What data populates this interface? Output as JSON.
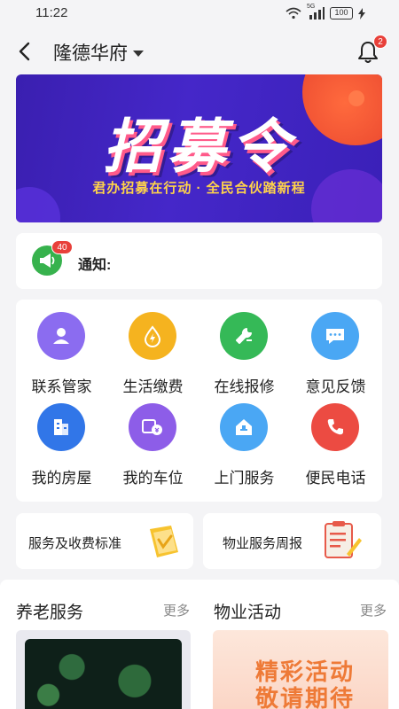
{
  "status_bar": {
    "time": "11:22",
    "battery": "100",
    "network": "5G"
  },
  "header": {
    "community_name": "隆德华府",
    "notification_count": "2"
  },
  "banner": {
    "title": "招募令",
    "subtitle": "君办招募在行动 · 全民合伙踏新程"
  },
  "notice": {
    "label": "通知:",
    "badge_count": "40"
  },
  "services": [
    {
      "label": "联系管家",
      "icon": "user-icon",
      "color": "#8b6cf0"
    },
    {
      "label": "生活缴费",
      "icon": "water-drop-icon",
      "color": "#f5b31f"
    },
    {
      "label": "在线报修",
      "icon": "wrench-icon",
      "color": "#35b957"
    },
    {
      "label": "意见反馈",
      "icon": "chat-bubble-icon",
      "color": "#4aa7f4"
    },
    {
      "label": "我的房屋",
      "icon": "building-icon",
      "color": "#3176e8"
    },
    {
      "label": "我的车位",
      "icon": "parking-icon",
      "color": "#8d5de8"
    },
    {
      "label": "上门服务",
      "icon": "house-service-icon",
      "color": "#4aa7f4"
    },
    {
      "label": "便民电话",
      "icon": "phone-icon",
      "color": "#ec4b42"
    }
  ],
  "quick_cards": [
    {
      "label": "服务及收费标准",
      "icon": "folder-icon"
    },
    {
      "label": "物业服务周报",
      "icon": "clipboard-icon"
    }
  ],
  "sections": {
    "elderly": {
      "title": "养老服务",
      "more": "更多"
    },
    "activity": {
      "title": "物业活动",
      "more": "更多",
      "thumb_text_1": "精彩活动",
      "thumb_text_2": "敬请期待"
    }
  }
}
